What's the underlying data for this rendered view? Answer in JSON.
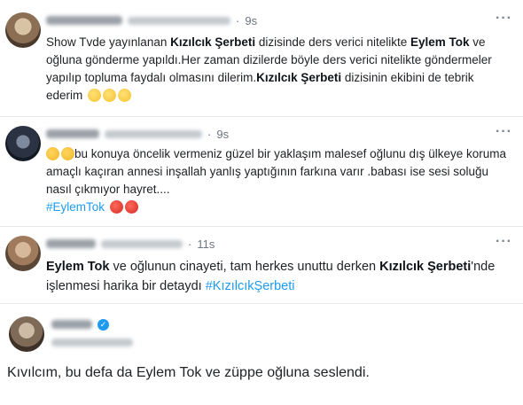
{
  "tweets": [
    {
      "time": "9s",
      "more": "···",
      "segments": [
        {
          "t": "Show Tvde yayınlanan ",
          "b": false
        },
        {
          "t": "Kızılcık Şerbeti",
          "b": true
        },
        {
          "t": " dizisinde ders verici nitelikte ",
          "b": false
        },
        {
          "t": "Eylem Tok",
          "b": true
        },
        {
          "t": " ve oğluna gönderme yapıldı.Her zaman dizilerde böyle ders verici nitelikte göndermeler yapılıp topluma faydalı olmasını dilerim.",
          "b": false
        },
        {
          "t": "Kızılcık Şerbeti",
          "b": true
        },
        {
          "t": " dizisinin ekibini de tebrik ederim",
          "b": false
        }
      ],
      "emojis": [
        "clapping-hands",
        "clapping-hands",
        "clapping-hands"
      ]
    },
    {
      "time": "9s",
      "more": "···",
      "pre_emojis": [
        "sad-face",
        "sad-face"
      ],
      "segments": [
        {
          "t": "bu konuya öncelik vermeniz güzel bir yaklaşım malesef oğlunu dış ülkeye koruma amaçlı kaçıran annesi inşallah yanlış yaptığının farkına varır .babası ise sesi soluğu nasıl çıkmıyor hayret....",
          "b": false
        }
      ],
      "hashtag": "#EylemTok",
      "emojis": [
        "angry-face",
        "angry-face"
      ]
    },
    {
      "time": "11s",
      "more": "···",
      "segments": [
        {
          "t": "Eylem Tok",
          "b": true
        },
        {
          "t": " ve oğlunun  cinayeti, tam herkes unuttu derken ",
          "b": false
        },
        {
          "t": "Kızılcık Şerbeti",
          "b": true
        },
        {
          "t": "'nde işlenmesi harika bir detaydı ",
          "b": false
        }
      ],
      "hashtag": "#KızılcıkŞerbeti"
    }
  ],
  "tweet4": {
    "verified_glyph": "✓"
  },
  "caption": "Kıvılcım, bu defa da Eylem Tok ve züppe oğluna seslendi.",
  "colors": {
    "hashtag": "#1d9bf0",
    "divider": "#e6e9ec",
    "muted": "#6b7680"
  }
}
